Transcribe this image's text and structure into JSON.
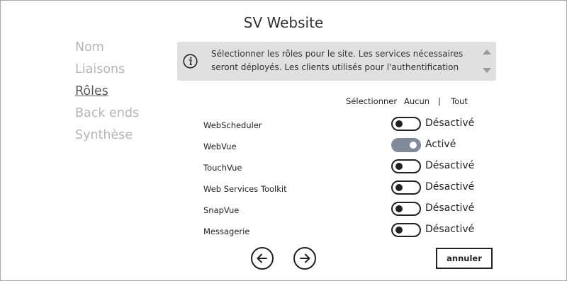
{
  "window": {
    "title": "SV Website"
  },
  "steps": [
    {
      "label": "Nom",
      "active": false
    },
    {
      "label": "Liaisons",
      "active": false
    },
    {
      "label": "Rôles",
      "active": true
    },
    {
      "label": "Back ends",
      "active": false
    },
    {
      "label": "Synthèse",
      "active": false
    }
  ],
  "info": {
    "icon": "info-icon",
    "text": "Sélectionner les rôles pour le site. Les services nécessaires seront déployés. Les clients utilisés pour l'authentification seront"
  },
  "selection": {
    "label": "Sélectionner",
    "none": "Aucun",
    "separator": "|",
    "all": "Tout"
  },
  "roles": [
    {
      "name": "WebScheduler",
      "enabled": false,
      "state": "Désactivé"
    },
    {
      "name": "WebVue",
      "enabled": true,
      "state": "Activé"
    },
    {
      "name": "TouchVue",
      "enabled": false,
      "state": "Désactivé"
    },
    {
      "name": "Web Services Toolkit",
      "enabled": false,
      "state": "Désactivé"
    },
    {
      "name": "SnapVue",
      "enabled": false,
      "state": "Désactivé"
    },
    {
      "name": "Messagerie",
      "enabled": false,
      "state": "Désactivé"
    }
  ],
  "footer": {
    "back_icon": "arrow-left-icon",
    "next_icon": "arrow-right-icon",
    "cancel": "annuler"
  },
  "colors": {
    "toggle_on": "#818a99",
    "info_bg": "#e0e0e0",
    "step_inactive": "#b5b5b5",
    "step_active": "#5a5a5a"
  }
}
